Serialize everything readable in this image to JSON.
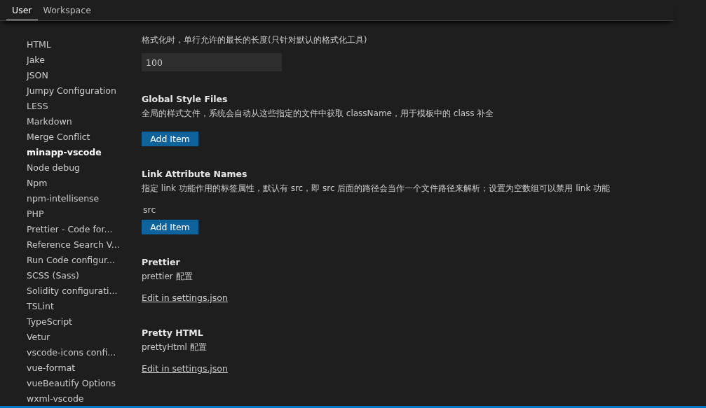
{
  "tabs": [
    {
      "label": "User",
      "selected": true
    },
    {
      "label": "Workspace",
      "selected": false
    }
  ],
  "sidebar": {
    "items": [
      {
        "label": "HTML",
        "selected": false
      },
      {
        "label": "Jake",
        "selected": false
      },
      {
        "label": "JSON",
        "selected": false
      },
      {
        "label": "Jumpy Configuration",
        "selected": false
      },
      {
        "label": "LESS",
        "selected": false
      },
      {
        "label": "Markdown",
        "selected": false
      },
      {
        "label": "Merge Conflict",
        "selected": false
      },
      {
        "label": "minapp-vscode",
        "selected": true
      },
      {
        "label": "Node debug",
        "selected": false
      },
      {
        "label": "Npm",
        "selected": false
      },
      {
        "label": "npm-intellisense",
        "selected": false
      },
      {
        "label": "PHP",
        "selected": false
      },
      {
        "label": "Prettier - Code for...",
        "selected": false
      },
      {
        "label": "Reference Search V...",
        "selected": false
      },
      {
        "label": "Run Code configur...",
        "selected": false
      },
      {
        "label": "SCSS (Sass)",
        "selected": false
      },
      {
        "label": "Solidity configurati...",
        "selected": false
      },
      {
        "label": "TSLint",
        "selected": false
      },
      {
        "label": "TypeScript",
        "selected": false
      },
      {
        "label": "Vetur",
        "selected": false
      },
      {
        "label": "vscode-icons confi...",
        "selected": false
      },
      {
        "label": "vue-format",
        "selected": false
      },
      {
        "label": "vueBeautify Options",
        "selected": false
      },
      {
        "label": "wxml-vscode",
        "selected": false
      }
    ]
  },
  "settings": [
    {
      "kind": "number",
      "description": "格式化时，单行允许的最长的长度(只针对默认的格式化工具)",
      "value": "100"
    },
    {
      "kind": "array",
      "title": "Global Style Files",
      "description": "全局的样式文件，系统会自动从这些指定的文件中获取 className，用于模板中的 class 补全",
      "button": "Add Item"
    },
    {
      "kind": "array",
      "title": "Link Attribute Names",
      "description": "指定 link 功能作用的标签属性，默认有 src，即 src 后面的路径会当作一个文件路径来解析；设置为空数组可以禁用 link 功能",
      "items": [
        "src"
      ],
      "button": "Add Item"
    },
    {
      "kind": "json",
      "title": "Prettier",
      "description": "prettier 配置",
      "link": "Edit in settings.json"
    },
    {
      "kind": "json",
      "title": "Pretty HTML",
      "description": "prettyHtml 配置",
      "link": "Edit in settings.json"
    }
  ]
}
